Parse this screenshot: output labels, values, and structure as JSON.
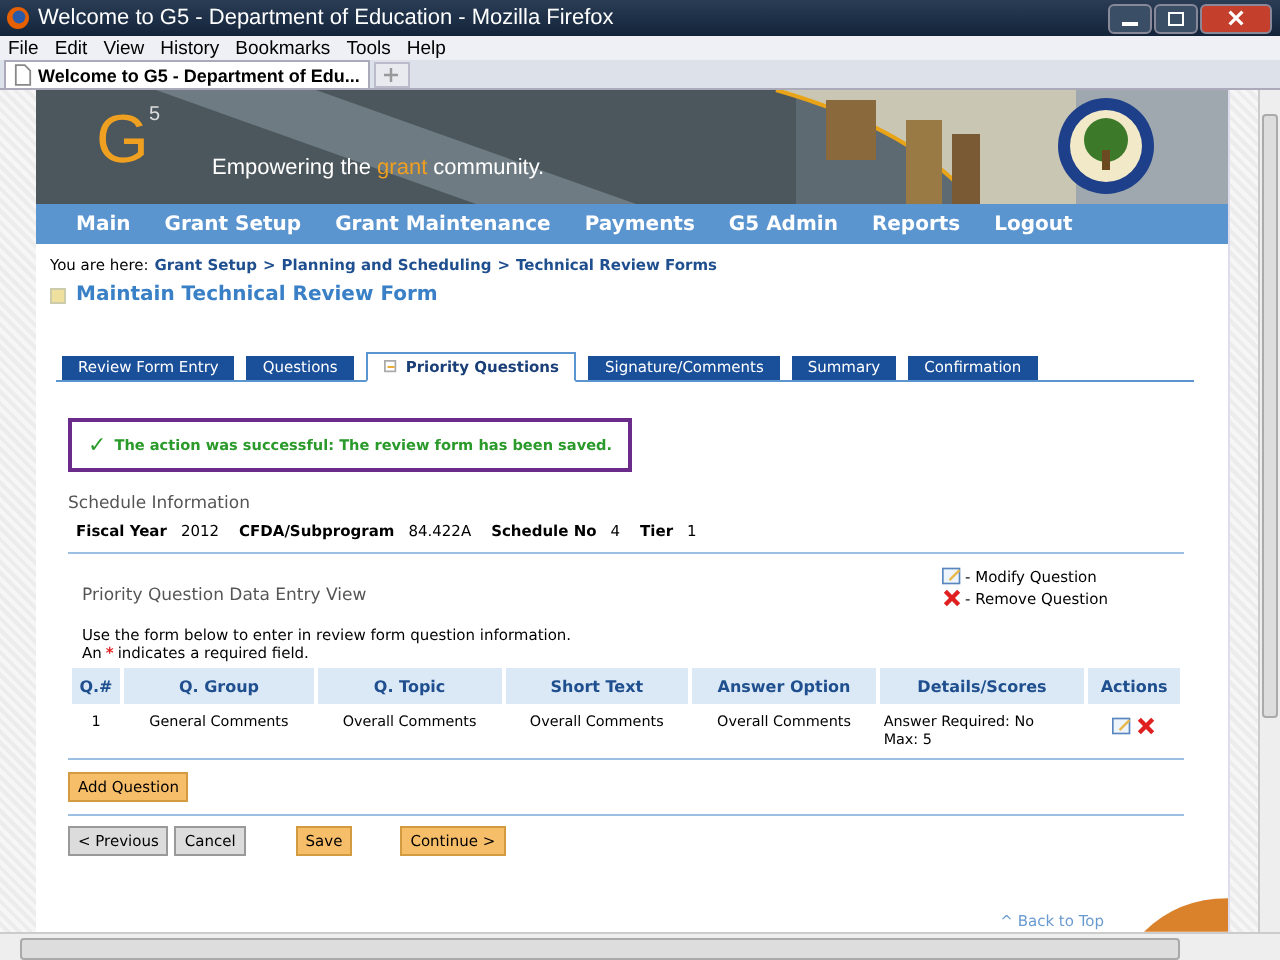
{
  "window": {
    "title": "Welcome to G5 - Department of Education - Mozilla Firefox"
  },
  "menu": [
    "File",
    "Edit",
    "View",
    "History",
    "Bookmarks",
    "Tools",
    "Help"
  ],
  "browser_tabs": [
    {
      "label": "Welcome to G5 - Department of Edu...",
      "selected": true
    }
  ],
  "banner": {
    "logo": "G",
    "logo_sup": "5",
    "tagline_before": "Empowering the ",
    "tagline_highlight": "grant",
    "tagline_after": " community."
  },
  "nav": [
    "Main",
    "Grant Setup",
    "Grant Maintenance",
    "Payments",
    "G5 Admin",
    "Reports",
    "Logout"
  ],
  "breadcrumb": {
    "prefix": "You are here:",
    "separator": ">",
    "items": [
      "Grant Setup",
      "Planning and Scheduling",
      "Technical Review Forms"
    ]
  },
  "page_title": "Maintain Technical Review Form",
  "form_tabs": [
    {
      "label": "Review Form Entry",
      "selected": false
    },
    {
      "label": "Questions",
      "selected": false
    },
    {
      "label": "Priority Questions",
      "selected": true
    },
    {
      "label": "Signature/Comments",
      "selected": false
    },
    {
      "label": "Summary",
      "selected": false
    },
    {
      "label": "Confirmation",
      "selected": false
    }
  ],
  "message": {
    "icon": "✓",
    "text": "The action was successful: The review form has been saved."
  },
  "schedule": {
    "heading": "Schedule Information",
    "fields": [
      {
        "label": "Fiscal Year",
        "value": "2012"
      },
      {
        "label": "CFDA/Subprogram",
        "value": "84.422A"
      },
      {
        "label": "Schedule No",
        "value": "4"
      },
      {
        "label": "Tier",
        "value": "1"
      }
    ]
  },
  "legend": [
    {
      "kind": "modify",
      "label": "- Modify Question"
    },
    {
      "kind": "remove",
      "label": "- Remove Question"
    }
  ],
  "section_heading": "Priority Question Data Entry View",
  "instructions": "Use the form below to enter in review form question information.",
  "required_note": {
    "before": "An",
    "mark": "*",
    "after": "indicates a required field."
  },
  "table": {
    "columns": [
      "Q.#",
      "Q. Group",
      "Q. Topic",
      "Short Text",
      "Answer Option",
      "Details/Scores",
      "Actions"
    ],
    "rows": [
      {
        "cells": [
          "1",
          "General Comments",
          "Overall Comments",
          "Overall Comments",
          "Overall Comments",
          "Answer Required: No\nMax: 5"
        ],
        "actions": [
          {
            "kind": "modify"
          },
          {
            "kind": "remove"
          }
        ]
      }
    ]
  },
  "add_button": "Add Question",
  "buttons": [
    {
      "label": "< Previous",
      "kind": "secondary"
    },
    {
      "label": "Cancel",
      "kind": "secondary"
    },
    {
      "label": "Save",
      "kind": "primary"
    },
    {
      "label": "Continue >",
      "kind": "primary"
    }
  ],
  "back_to_top": "^ Back to Top"
}
